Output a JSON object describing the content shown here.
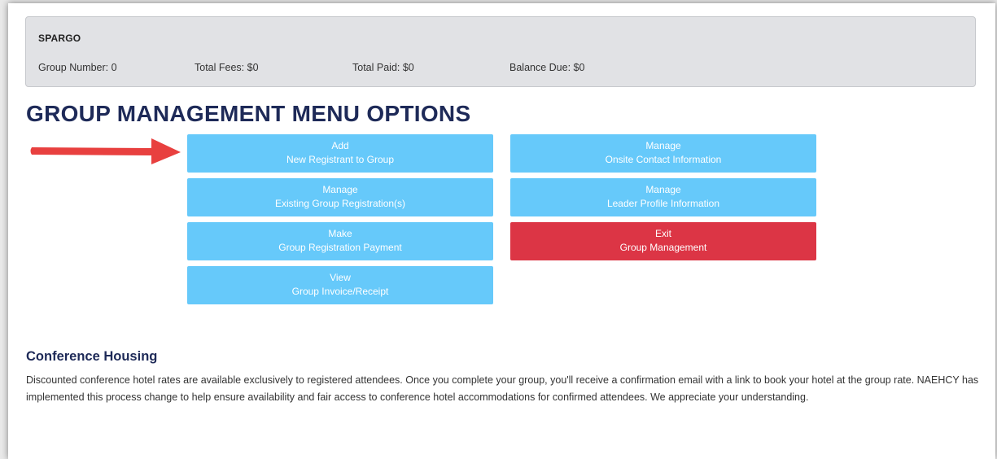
{
  "group": {
    "name": "SPARGO",
    "group_number": "Group Number: 0",
    "total_fees": "Total Fees: $0",
    "total_paid": "Total Paid: $0",
    "balance_due": "Balance Due: $0"
  },
  "menu": {
    "title": "GROUP MANAGEMENT MENU OPTIONS",
    "buttons": [
      {
        "line1": "Add",
        "line2": "New Registrant to Group"
      },
      {
        "line1": "Manage",
        "line2": "Existing Group Registration(s)"
      },
      {
        "line1": "Make",
        "line2": "Group Registration Payment"
      },
      {
        "line1": "View",
        "line2": "Group Invoice/Receipt"
      },
      {
        "line1": "Manage",
        "line2": "Onsite Contact Information"
      },
      {
        "line1": "Manage",
        "line2": "Leader Profile Information"
      },
      {
        "line1": "Exit",
        "line2": "Group Management"
      }
    ]
  },
  "housing": {
    "title": "Conference Housing",
    "body": "Discounted conference hotel rates are available exclusively to registered attendees. Once you complete your group, you'll receive a confirmation email with a link to book your hotel at the group rate. NAEHCY has implemented this process change to help ensure availability and fair access to conference hotel accommodations for confirmed attendees. We appreciate your understanding."
  },
  "colors": {
    "button_blue": "#66c9fa",
    "button_red": "#dc3545",
    "heading_navy": "#1e2a58",
    "annotation_arrow": "#e8403f"
  },
  "annotation": {
    "icon": "red-arrow-right-icon"
  }
}
